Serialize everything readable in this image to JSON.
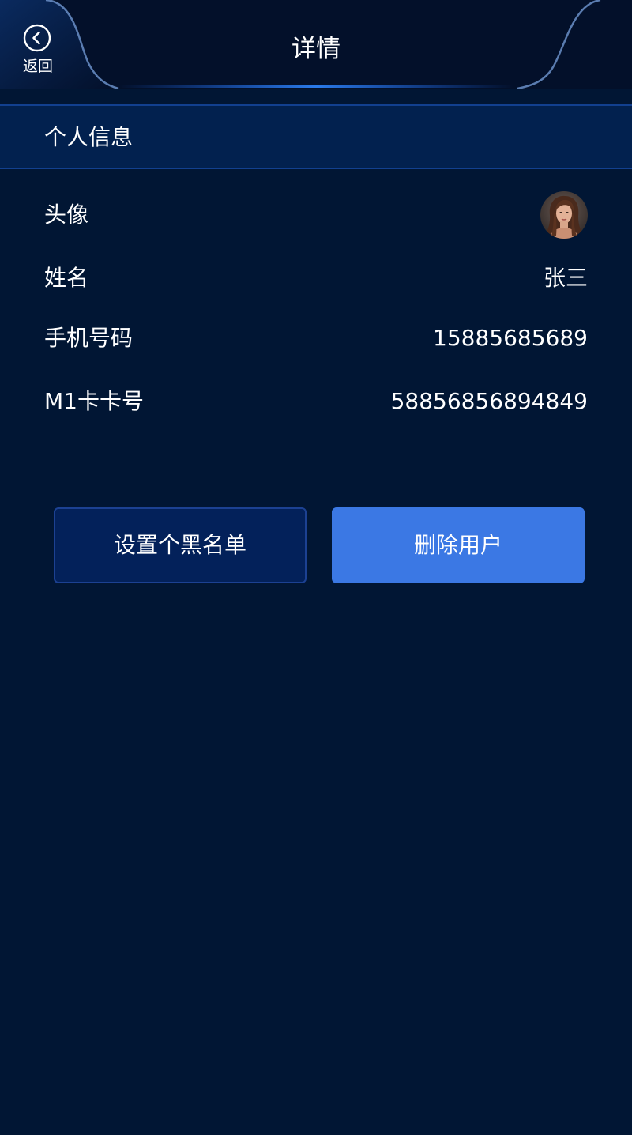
{
  "header": {
    "back_label": "返回",
    "title": "详情"
  },
  "section": {
    "title": "个人信息"
  },
  "rows": [
    {
      "label": "头像",
      "value": ""
    },
    {
      "label": "姓名",
      "value": "张三"
    },
    {
      "label": "手机号码",
      "value": "15885685689"
    },
    {
      "label": "M1卡卡号",
      "value": "58856856894849"
    }
  ],
  "actions": {
    "blacklist_label": "设置个黑名单",
    "delete_label": "删除用户"
  },
  "colors": {
    "background": "#011634",
    "header_background": "#03102a",
    "section_background": "#02214f",
    "accent": "#3b78e4",
    "secondary_button": "#03215a"
  },
  "icons": {
    "back": "chevron-left-circle-icon"
  }
}
